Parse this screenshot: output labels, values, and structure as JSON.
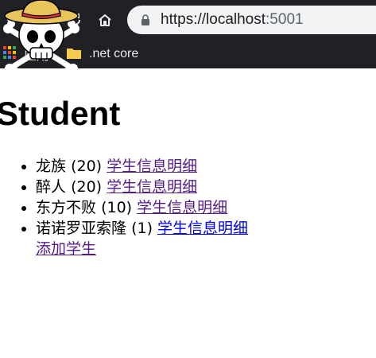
{
  "browser": {
    "url_host": "https://localhost",
    "url_port": ":5001",
    "bookmarks": [
      {
        "label": "应用",
        "icon": "apps-grid-icon"
      },
      {
        "label": ".net core",
        "icon": "folder-icon"
      }
    ],
    "nav_icons": [
      "back-icon",
      "forward-icon",
      "reload-icon",
      "home-icon"
    ]
  },
  "page": {
    "title": "Student",
    "students": [
      {
        "name": "龙族",
        "age": "(20)",
        "link": "学生信息明细"
      },
      {
        "name": "醉人",
        "age": "(20)",
        "link": "学生信息明细"
      },
      {
        "name": "东方不败",
        "age": "(10)",
        "link": "学生信息明细"
      },
      {
        "name": "诺诺罗亚索隆",
        "age": "(1)",
        "link": "学生信息明细"
      }
    ],
    "add_link": "添加学生"
  },
  "colors": {
    "chrome_bg": "#202124",
    "address_bg": "#f1f3f4",
    "visited_link": "#551a8b",
    "link": "#0000ee"
  }
}
